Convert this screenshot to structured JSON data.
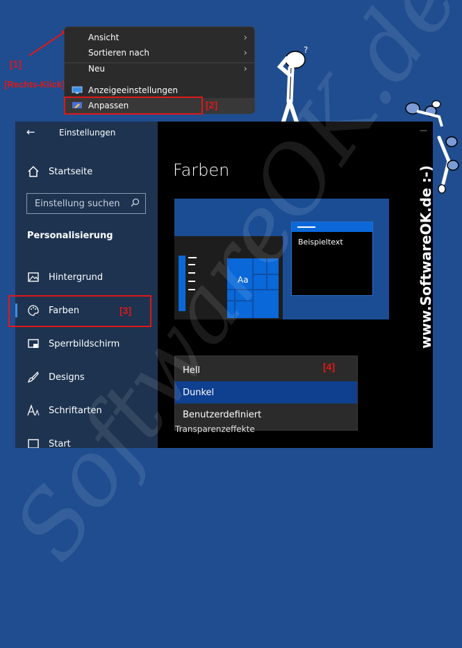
{
  "watermark": "SoftwareOK.de",
  "vertical_text": "www.SoftwareOK.de :-)",
  "annotations": {
    "label1": "[1]",
    "label1b": "[Rechts-Klick]",
    "label2": "[2]",
    "label3": "[3]",
    "label4": "[4]"
  },
  "context_menu": {
    "items": [
      {
        "label": "Ansicht",
        "arrow": "›"
      },
      {
        "label": "Sortieren nach",
        "arrow": "›"
      },
      {
        "label": "Neu",
        "arrow": "›"
      },
      {
        "label": "Anzeigeeinstellungen"
      },
      {
        "label": "Anpassen"
      }
    ]
  },
  "window": {
    "back_glyph": "←",
    "title": "Einstellungen",
    "minimize_glyph": "—"
  },
  "sidebar": {
    "home": "Startseite",
    "search_placeholder": "Einstellung suchen",
    "section": "Personalisierung",
    "items": [
      {
        "label": "Hintergrund",
        "icon": "image-icon"
      },
      {
        "label": "Farben",
        "icon": "palette-icon"
      },
      {
        "label": "Sperrbildschirm",
        "icon": "lock-screen-icon"
      },
      {
        "label": "Designs",
        "icon": "brush-icon"
      },
      {
        "label": "Schriftarten",
        "icon": "font-icon"
      },
      {
        "label": "Start",
        "icon": "start-icon"
      }
    ]
  },
  "main": {
    "title": "Farben",
    "preview": {
      "tile_label": "Aa",
      "sample_text": "Beispieltext"
    },
    "dropdown": {
      "options": [
        "Hell",
        "Dunkel",
        "Benutzerdefiniert"
      ],
      "selected": "Dunkel"
    },
    "transparency_label": "Transparenzeffekte"
  },
  "colors": {
    "accent": "#0a58c8",
    "highlight": "#0f3f8f",
    "annotation_red": "#e01818",
    "sidebar_bg": "#1d3350"
  }
}
